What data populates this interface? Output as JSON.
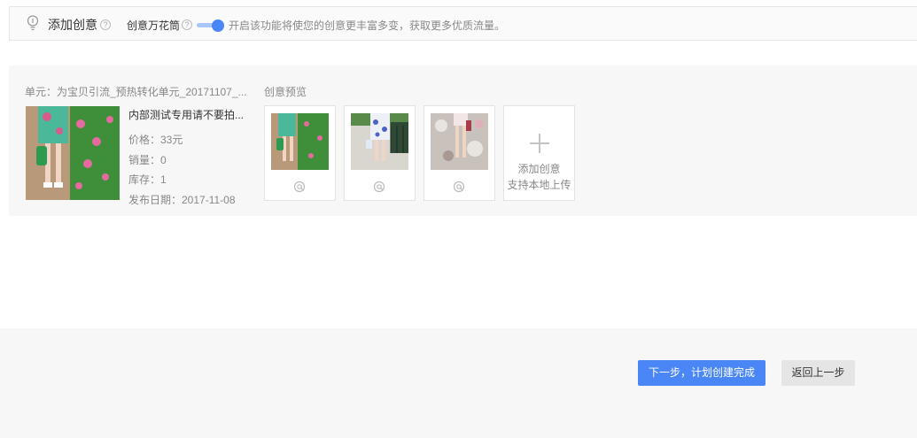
{
  "header": {
    "title": "添加创意",
    "help_glyph": "?",
    "kaleidoscope_label": "创意万花筒",
    "kaleidoscope_enabled": true,
    "description": "开启该功能将使您的创意更丰富多变，获取更多优质流量。",
    "accent_color": "#4a86f5"
  },
  "unit": {
    "title": "单元：为宝贝引流_预热转化单元_20171107_...",
    "preview_title": "创意预览",
    "product": {
      "name": "内部测试专用请不要拍...",
      "price": "价格：33元",
      "sales": "销量：0",
      "stock": "库存：1",
      "publish_date": "发布日期：2017-11-08"
    },
    "creatives": [
      {
        "icon": "at-icon"
      },
      {
        "icon": "at-icon"
      },
      {
        "icon": "at-icon"
      }
    ],
    "add_card": {
      "line1": "添加创意",
      "line2": "支持本地上传"
    }
  },
  "footer": {
    "next_label": "下一步，计划创建完成",
    "back_label": "返回上一步"
  }
}
